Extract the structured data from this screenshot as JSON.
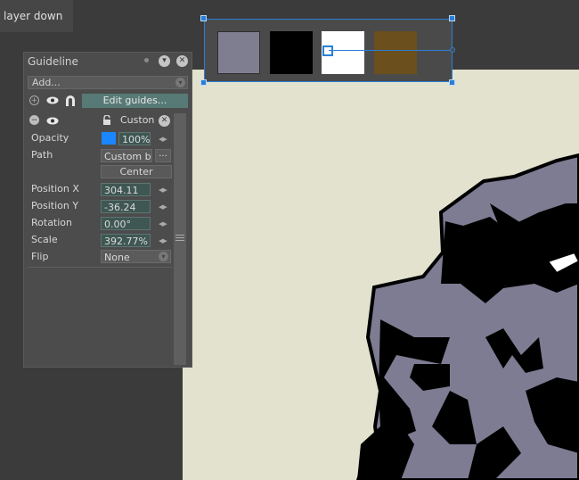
{
  "top_chip": {
    "label": "layer down"
  },
  "colors": {
    "accent": "#2a7fd6",
    "swatches": [
      "#7f7e91",
      "#000000",
      "#ffffff",
      "#6b4f1c"
    ],
    "opacity_color": "#1a86ff"
  },
  "panel": {
    "title": "Guideline",
    "add_label": "Add...",
    "edit_guides_label": "Edit guides...",
    "guide_name": "Custon",
    "properties": {
      "opacity": {
        "label": "Opacity",
        "value": "100%"
      },
      "path": {
        "label": "Path",
        "value": "Custom b",
        "browse": "..."
      },
      "center": {
        "label": "Center"
      },
      "position_x": {
        "label": "Position X",
        "value": "304.11"
      },
      "position_y": {
        "label": "Position Y",
        "value": "-36.24"
      },
      "rotation": {
        "label": "Rotation",
        "value": "0.00°"
      },
      "scale": {
        "label": "Scale",
        "value": "392.77%"
      },
      "flip": {
        "label": "Flip",
        "value": "None"
      }
    }
  },
  "icons": {
    "pin": "pin-icon",
    "collapse": "chevron-down-icon",
    "close": "close-icon",
    "add": "plus-icon",
    "eye": "eye-icon",
    "magnet": "magnet-icon",
    "lock": "lock-icon"
  }
}
